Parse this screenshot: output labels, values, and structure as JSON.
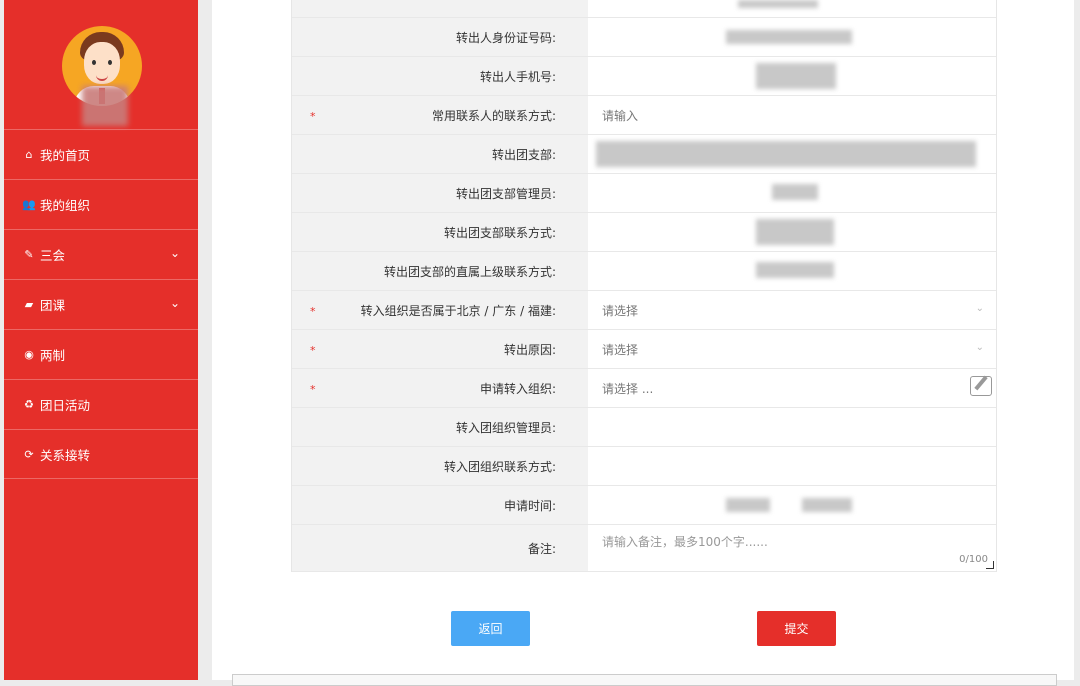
{
  "colors": {
    "primary": "#e52f2a",
    "back_button": "#4aa8f5",
    "label_bg": "#f2f2f2"
  },
  "sidebar": {
    "avatar_icon": "user-avatar-cartoon",
    "items": [
      {
        "label": "我的首页",
        "icon": "home-icon",
        "glyph": "⌂",
        "expandable": false
      },
      {
        "label": "我的组织",
        "icon": "group-icon",
        "glyph": "👥",
        "expandable": false
      },
      {
        "label": "三会",
        "icon": "edit-square-icon",
        "glyph": "✎",
        "expandable": true
      },
      {
        "label": "团课",
        "icon": "folder-open-icon",
        "glyph": "▰",
        "expandable": true
      },
      {
        "label": "两制",
        "icon": "target-icon",
        "glyph": "◉",
        "expandable": false
      },
      {
        "label": "团日活动",
        "icon": "recycle-icon",
        "glyph": "♻",
        "expandable": false
      },
      {
        "label": "关系接转",
        "icon": "refresh-icon",
        "glyph": "⟳",
        "expandable": false
      }
    ]
  },
  "form": {
    "rows": [
      {
        "label": "转出人身份证号码:"
      },
      {
        "label": "转出人手机号:"
      },
      {
        "label": "常用联系人的联系方式:",
        "required": true,
        "placeholder": "请输入"
      },
      {
        "label": "转出团支部:"
      },
      {
        "label": "转出团支部管理员:"
      },
      {
        "label": "转出团支部联系方式:"
      },
      {
        "label": "转出团支部的直属上级联系方式:"
      },
      {
        "label": "转入组织是否属于北京 / 广东 / 福建:",
        "required": true,
        "placeholder": "请选择"
      },
      {
        "label": "转出原因:",
        "required": true,
        "placeholder": "请选择"
      },
      {
        "label": "申请转入组织:",
        "required": true,
        "placeholder": "请选择 ..."
      },
      {
        "label": "转入团组织管理员:"
      },
      {
        "label": "转入团组织联系方式:"
      },
      {
        "label": "申请时间:"
      },
      {
        "label": "备注:",
        "placeholder": "请输入备注，最多100个字......",
        "counter": "0/100"
      }
    ],
    "required_mark": "*"
  },
  "buttons": {
    "back": "返回",
    "submit": "提交"
  }
}
